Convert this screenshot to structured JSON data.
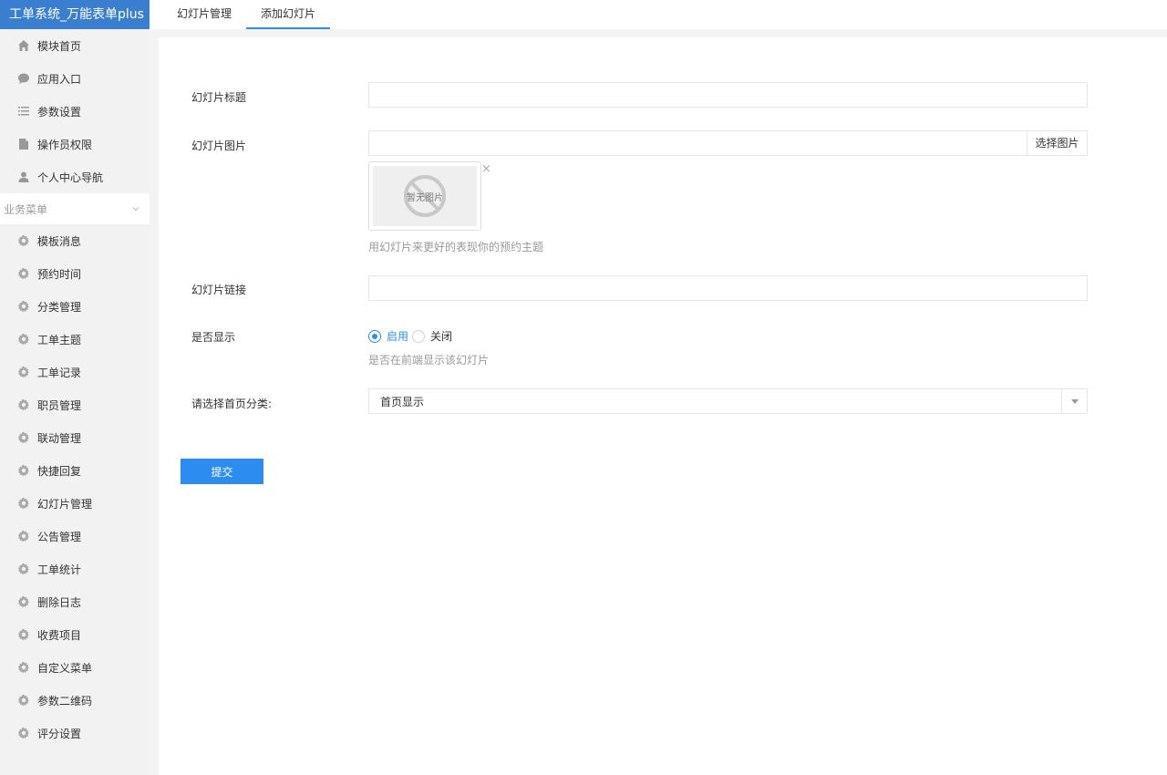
{
  "app": {
    "title": "工单系统_万能表单plus"
  },
  "sidebar": {
    "top_items": [
      {
        "label": "模块首页",
        "icon": "home-icon"
      },
      {
        "label": "应用入口",
        "icon": "chat-bubble-icon"
      },
      {
        "label": "参数设置",
        "icon": "list-icon"
      },
      {
        "label": "操作员权限",
        "icon": "document-icon"
      },
      {
        "label": "个人中心导航",
        "icon": "user-icon"
      }
    ],
    "group_label": "业务菜单",
    "group_items": [
      {
        "label": "模板消息",
        "icon": "gear-icon"
      },
      {
        "label": "预约时间",
        "icon": "gear-icon"
      },
      {
        "label": "分类管理",
        "icon": "gear-icon"
      },
      {
        "label": "工单主题",
        "icon": "gear-icon"
      },
      {
        "label": "工单记录",
        "icon": "gear-icon"
      },
      {
        "label": "职员管理",
        "icon": "gear-icon"
      },
      {
        "label": "联动管理",
        "icon": "gear-icon"
      },
      {
        "label": "快捷回复",
        "icon": "gear-icon"
      },
      {
        "label": "幻灯片管理",
        "icon": "gear-icon"
      },
      {
        "label": "公告管理",
        "icon": "gear-icon"
      },
      {
        "label": "工单统计",
        "icon": "gear-icon"
      },
      {
        "label": "删除日志",
        "icon": "gear-icon"
      },
      {
        "label": "收费项目",
        "icon": "gear-icon"
      },
      {
        "label": "自定义菜单",
        "icon": "gear-icon"
      },
      {
        "label": "参数二维码",
        "icon": "gear-icon"
      },
      {
        "label": "评分设置",
        "icon": "gear-icon"
      }
    ]
  },
  "tabs": [
    {
      "label": "幻灯片管理",
      "active": false
    },
    {
      "label": "添加幻灯片",
      "active": true
    }
  ],
  "form": {
    "title_label": "幻灯片标题",
    "title_value": "",
    "image_label": "幻灯片图片",
    "image_value": "",
    "image_button": "选择图片",
    "image_placeholder_text": "暂无图片",
    "image_close": "×",
    "image_help": "用幻灯片来更好的表现你的预约主题",
    "link_label": "幻灯片链接",
    "link_value": "",
    "show_label": "是否显示",
    "show_options": [
      {
        "label": "启用",
        "checked": true
      },
      {
        "label": "关闭",
        "checked": false
      }
    ],
    "show_help": "是否在前端显示该幻灯片",
    "category_label": "请选择首页分类:",
    "category_value": "首页显示",
    "submit_label": "提交"
  },
  "colors": {
    "brand": "#3a7fcf",
    "accent": "#2d8cf0"
  }
}
